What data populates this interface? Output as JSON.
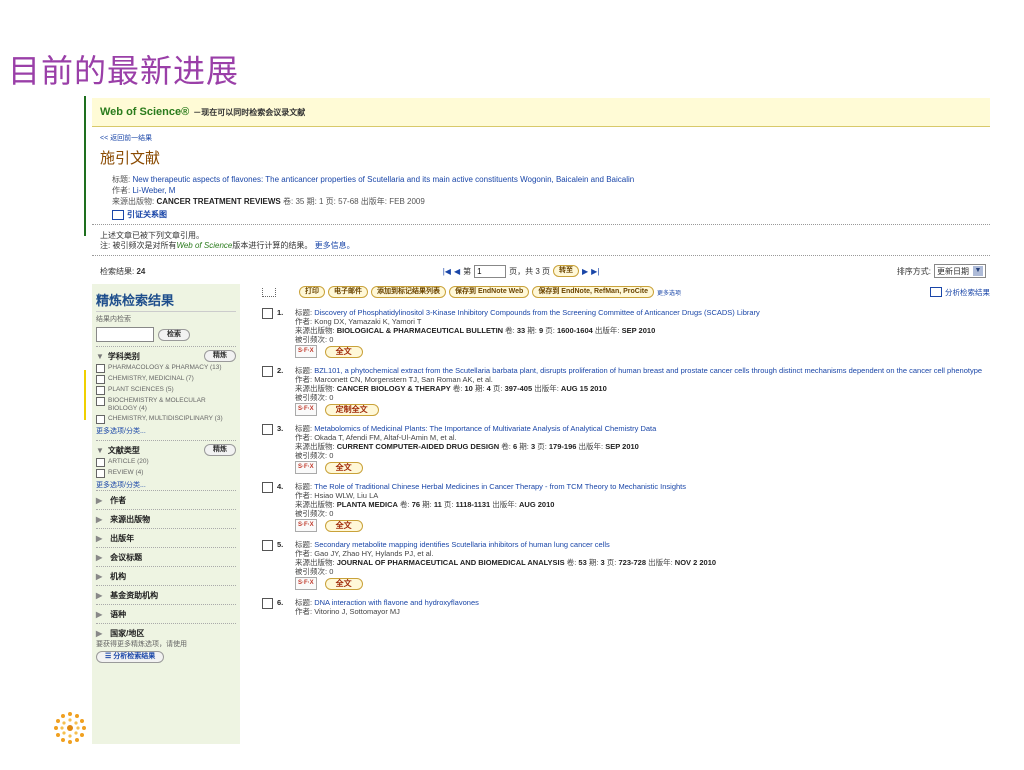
{
  "slide": {
    "title": "目前的最新进展"
  },
  "header": {
    "brand": "Web of Science®",
    "tagline": "－现在可以同时检索会议录文献"
  },
  "back_link": "<< 返回前一结果",
  "section_title": "施引文献",
  "source_record": {
    "title_label": "标题:",
    "title": "New therapeutic aspects of flavones: The anticancer properties of Scutellaria and its main active constituents Wogonin, Baicalein and Baicalin",
    "author_label": "作者:",
    "author": "Li-Weber, M",
    "source_label": "来源出版物:",
    "source": "CANCER TREATMENT REVIEWS",
    "source_detail": "卷: 35 期: 1 页: 57-68 出版年: FEB 2009",
    "citation_map": "引证关系图"
  },
  "notice": {
    "line1": "上述文章已被下列文章引用。",
    "line2_pre": "注: 被引频次是对所有",
    "line2_italic": "Web of Science",
    "line2_post": "版本进行计算的结果。",
    "more_info": "更多信息。"
  },
  "results": {
    "label": "检索结果:",
    "count": "24",
    "page_prefix": "第",
    "page_value": "1",
    "page_suffix": "页，共 3 页",
    "go": "转至",
    "sort_label": "排序方式:",
    "sort_value": "更新日期"
  },
  "toolbar": {
    "print": "打印",
    "email": "电子邮件",
    "add_marked": "添加到标记结果列表",
    "save_endnote_web": "保存到 EndNote Web",
    "save_endnote": "保存到 EndNote, RefMan, ProCite",
    "more_options": "更多选项",
    "analyze": "分析检索结果"
  },
  "refine": {
    "title": "精炼检索结果",
    "within_label": "结果内检索",
    "search_btn": "检索",
    "refine_btn": "精炼",
    "subject": {
      "label": "学科类别",
      "options": [
        "PHARMACOLOGY & PHARMACY (13)",
        "CHEMISTRY, MEDICINAL (7)",
        "PLANT SCIENCES (5)",
        "BIOCHEMISTRY & MOLECULAR BIOLOGY (4)",
        "CHEMISTRY, MULTIDISCIPLINARY (3)"
      ],
      "more": "更多选项/分类..."
    },
    "doctype": {
      "label": "文献类型",
      "options": [
        "ARTICLE (20)",
        "REVIEW (4)"
      ],
      "more": "更多选项/分类..."
    },
    "collapsed": [
      "作者",
      "来源出版物",
      "出版年",
      "会议标题",
      "机构",
      "基金资助机构",
      "语种",
      "国家/地区"
    ],
    "hint": "要获得更多精炼选项，请使用",
    "analyze_btn": "分析检索结果"
  },
  "labels": {
    "title": "标题:",
    "author": "作者:",
    "source": "来源出版物:",
    "cited": "被引频次:",
    "sfx": "S·F·X",
    "vol": "卷:",
    "issue": "期:",
    "pages": "页:",
    "year": "出版年:"
  },
  "records": [
    {
      "num": "1.",
      "title": "Discovery of Phosphatidylinositol 3-Kinase Inhibitory Compounds from the Screening Committee of Anticancer Drugs (SCADS) Library",
      "authors": "Kong DX, Yamazaki K, Yamori T",
      "source": "BIOLOGICAL & PHARMACEUTICAL BULLETIN",
      "vol": "33",
      "issue": "9",
      "pages": "1600-1604",
      "year": "SEP 2010",
      "cited": "0",
      "fulltext": "全文"
    },
    {
      "num": "2.",
      "title": "BZL101, a phytochemical extract from the Scutellaria barbata plant, disrupts proliferation of human breast and prostate cancer cells through distinct mechanisms dependent on the cancer cell phenotype",
      "authors": "Marconett CN, Morgenstern TJ, San Roman AK, et al.",
      "source": "CANCER BIOLOGY & THERAPY",
      "vol": "10",
      "issue": "4",
      "pages": "397-405",
      "year": "AUG 15 2010",
      "cited": "0",
      "fulltext": "定制全文"
    },
    {
      "num": "3.",
      "title": "Metabolomics of Medicinal Plants: The Importance of Multivariate Analysis of Analytical Chemistry Data",
      "authors": "Okada T, Afendi FM, Altaf-Ul-Amin M, et al.",
      "source": "CURRENT COMPUTER-AIDED DRUG DESIGN",
      "vol": "6",
      "issue": "3",
      "pages": "179-196",
      "year": "SEP 2010",
      "cited": "0",
      "fulltext": "全文"
    },
    {
      "num": "4.",
      "title": "The Role of Traditional Chinese Herbal Medicines in Cancer Therapy - from TCM Theory to Mechanistic Insights",
      "authors": "Hsiao WLW, Liu LA",
      "source": "PLANTA MEDICA",
      "vol": "76",
      "issue": "11",
      "pages": "1118-1131",
      "year": "AUG 2010",
      "cited": "0",
      "fulltext": "全文"
    },
    {
      "num": "5.",
      "title": "Secondary metabolite mapping identifies Scutellaria inhibitors of human lung cancer cells",
      "authors": "Gao JY, Zhao HY, Hylands PJ, et al.",
      "source": "JOURNAL OF PHARMACEUTICAL AND BIOMEDICAL ANALYSIS",
      "vol": "53",
      "issue": "3",
      "pages": "723-728",
      "year": "NOV 2 2010",
      "cited": "0",
      "fulltext": "全文"
    },
    {
      "num": "6.",
      "title": "DNA interaction with flavone and hydroxyflavones",
      "authors": "Vitorino J, Sottomayor MJ",
      "source": "",
      "vol": "",
      "issue": "",
      "pages": "",
      "year": "",
      "cited": "",
      "fulltext": ""
    }
  ],
  "colors": {
    "slide_title": "#9a3fa8",
    "brand_green": "#2a7b1c",
    "link_blue": "#1a46a8",
    "refine_bg": "#eef4e2",
    "header_bg": "#fffbd6"
  }
}
